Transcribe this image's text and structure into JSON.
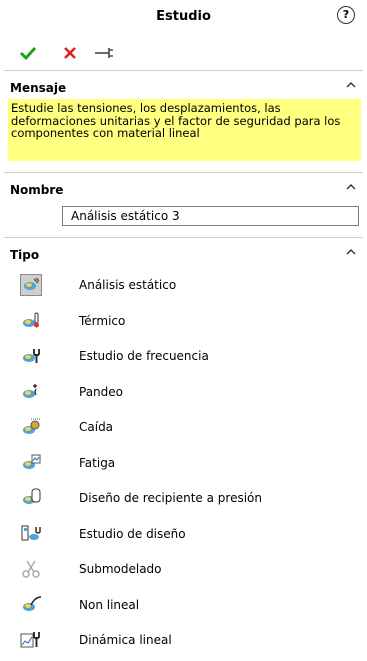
{
  "panel": {
    "title": "Estudio",
    "help_icon": "question-mark"
  },
  "actions": {
    "accept_icon": "checkmark-icon",
    "cancel_icon": "x-icon",
    "pin_icon": "pushpin-icon"
  },
  "message_section": {
    "title": "Mensaje",
    "text": "Estudie las tensiones, los desplazamientos, las deformaciones unitarias y el factor de seguridad para los componentes con material lineal",
    "background_color": "#ffff80"
  },
  "name_section": {
    "title": "Nombre",
    "value": "Análisis estático 3"
  },
  "type_section": {
    "title": "Tipo",
    "options": [
      {
        "label": "Análisis estático",
        "icon": "static-analysis-icon",
        "selected": true
      },
      {
        "label": "Térmico",
        "icon": "thermal-icon"
      },
      {
        "label": "Estudio de frecuencia",
        "icon": "frequency-icon"
      },
      {
        "label": "Pandeo",
        "icon": "buckling-icon"
      },
      {
        "label": "Caída",
        "icon": "drop-test-icon"
      },
      {
        "label": "Fatiga",
        "icon": "fatigue-icon"
      },
      {
        "label": "Diseño de recipiente a presión",
        "icon": "pressure-vessel-icon"
      },
      {
        "label": "Estudio de diseño",
        "icon": "design-study-icon"
      },
      {
        "label": "Submodelado",
        "icon": "submodeling-icon",
        "disabled": true
      },
      {
        "label": "Non lineal",
        "icon": "nonlinear-icon"
      },
      {
        "label": "Dinámica lineal",
        "icon": "linear-dynamics-icon"
      }
    ]
  }
}
